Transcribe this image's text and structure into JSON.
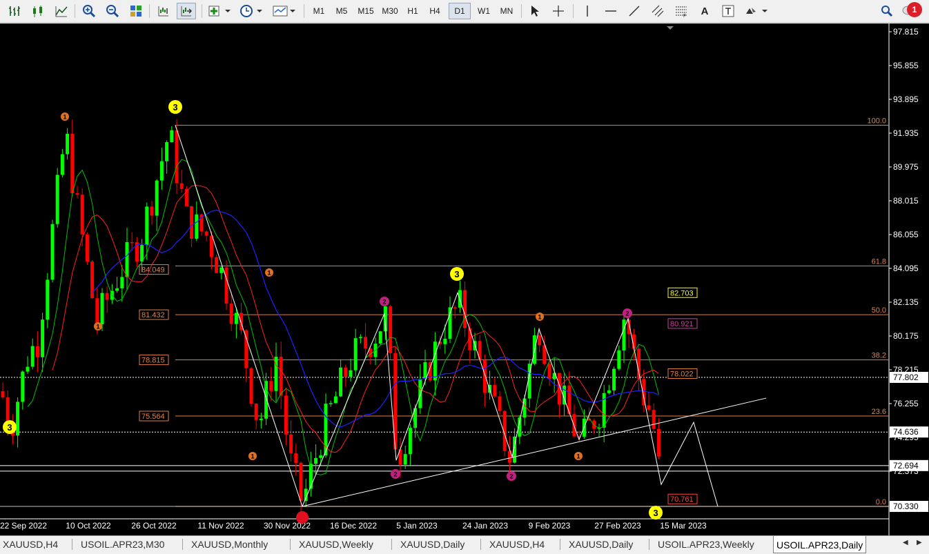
{
  "toolbar": {
    "timeframes": [
      "M1",
      "M5",
      "M15",
      "M30",
      "H1",
      "H4",
      "D1",
      "W1",
      "MN"
    ],
    "active_timeframe": "D1",
    "text_tool_label": "A",
    "notification_count": "1"
  },
  "chart": {
    "symbol": "USOIL.APR23",
    "timeframe": "Daily",
    "price_scale": {
      "ticks": [
        "97.815",
        "95.855",
        "93.895",
        "91.935",
        "89.975",
        "88.015",
        "86.055",
        "84.095",
        "82.135",
        "80.175",
        "78.215",
        "76.255",
        "74.295",
        "72.373"
      ],
      "highlighted_prices": [
        {
          "label": "77.802",
          "kind": "white"
        },
        {
          "label": "74.636",
          "kind": "white"
        },
        {
          "label": "72.694",
          "kind": "white"
        },
        {
          "label": "70.330",
          "kind": "white"
        }
      ]
    },
    "time_scale": [
      "22 Sep 2022",
      "10 Oct 2022",
      "26 Oct 2022",
      "11 Nov 2022",
      "30 Nov 2022",
      "16 Dec 2022",
      "5 Jan 2023",
      "24 Jan 2023",
      "9 Feb 2023",
      "27 Feb 2023",
      "15 Mar 2023"
    ],
    "fib_levels": [
      {
        "ratio": "100.0",
        "price": 92.4
      },
      {
        "ratio": "61.8",
        "price": 84.25
      },
      {
        "ratio": "50.0",
        "price": 81.432
      },
      {
        "ratio": "38.2",
        "price": 78.815
      },
      {
        "ratio": "23.6",
        "price": 75.564
      },
      {
        "ratio": "0.0",
        "price": 70.33
      }
    ],
    "fib_price_labels": [
      "84.049",
      "81.432",
      "78.815",
      "75.564"
    ],
    "right_price_labels": [
      "82.703",
      "80.921",
      "78.022",
      "70.761"
    ],
    "wave_labels": [
      {
        "text": "3",
        "color": "yellow"
      },
      {
        "text": "1",
        "color": "orange"
      },
      {
        "text": "2",
        "color": "magenta"
      }
    ],
    "colors": {
      "bull_candle": "#00ff00",
      "bear_candle": "#ff0000",
      "fib": "#e08040",
      "ma_fast": "#00c000",
      "ma_mid": "#ff2020",
      "ma_slow": "#2020ff",
      "wave_yellow": "#ffff00",
      "wave_orange": "#e07020",
      "wave_magenta": "#c02080"
    }
  },
  "tabs": [
    "XAUUSD,H4",
    "USOIL.APR23,M30",
    "XAUUSD,Monthly",
    "XAUUSD,Weekly",
    "XAUUSD,Daily",
    "XAUUSD,H4",
    "XAUUSD,Daily",
    "USOIL.APR23,Weekly",
    "USOIL.APR23,Daily"
  ],
  "active_tab": "USOIL.APR23,Daily"
}
